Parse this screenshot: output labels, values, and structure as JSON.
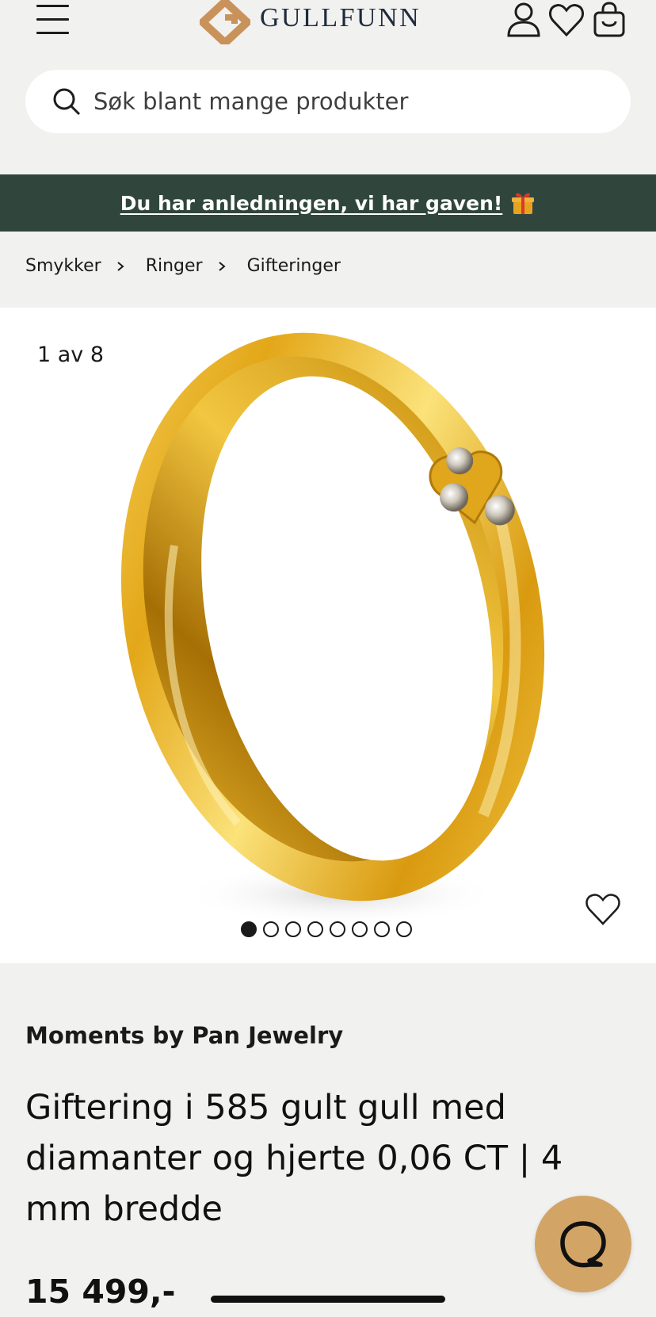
{
  "header": {
    "logo_text": "GULLFUNN",
    "icons": [
      "menu-icon",
      "user-icon",
      "heart-icon",
      "shopping-bag-icon"
    ]
  },
  "search": {
    "placeholder": "Søk blant mange produkter"
  },
  "promo": {
    "text": "Du har anledningen, vi har gaven!",
    "background_color": "#30463d"
  },
  "breadcrumb": {
    "items": [
      "Smykker",
      "Ringer",
      "Gifteringer"
    ]
  },
  "gallery": {
    "counter": "1 av 8",
    "current_index": 1,
    "total_images": 8
  },
  "product": {
    "brand": "Moments by Pan Jewelry",
    "title": "Giftering i 585 gult gull med diamanter og hjerte 0,06 CT | 4 mm bredde",
    "price": "15 499,-"
  },
  "colors": {
    "page_background": "#f1f1f0",
    "logo_accent": "#c9925a",
    "chat_button": "#d2a567"
  }
}
